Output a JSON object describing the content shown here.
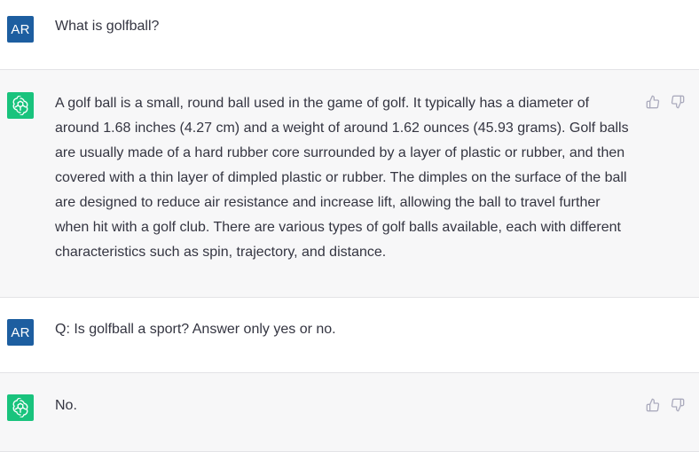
{
  "messages": [
    {
      "role": "user",
      "avatar_text": "AR",
      "text": "What is golfball?"
    },
    {
      "role": "assistant",
      "icon": "openai-logo-icon",
      "text": "A golf ball is a small, round ball used in the game of golf. It typically has a diameter of around 1.68 inches (4.27 cm) and a weight of around 1.62 ounces (45.93 grams). Golf balls are usually made of a hard rubber core surrounded by a layer of plastic or rubber, and then covered with a thin layer of dimpled plastic or rubber. The dimples on the surface of the ball are designed to reduce air resistance and increase lift, allowing the ball to travel further when hit with a golf club. There are various types of golf balls available, each with different characteristics such as spin, trajectory, and distance."
    },
    {
      "role": "user",
      "avatar_text": "AR",
      "text": "Q: Is golfball a sport? Answer only yes or no."
    },
    {
      "role": "assistant",
      "icon": "openai-logo-icon",
      "text": "No."
    }
  ],
  "colors": {
    "user_avatar_bg": "#1d5ea0",
    "assistant_avatar_bg": "#19c37d",
    "assistant_row_bg": "#f7f7f8",
    "text": "#343541",
    "icon": "#acacbe"
  },
  "icons": {
    "thumbs_up": "thumbs-up-icon",
    "thumbs_down": "thumbs-down-icon"
  }
}
